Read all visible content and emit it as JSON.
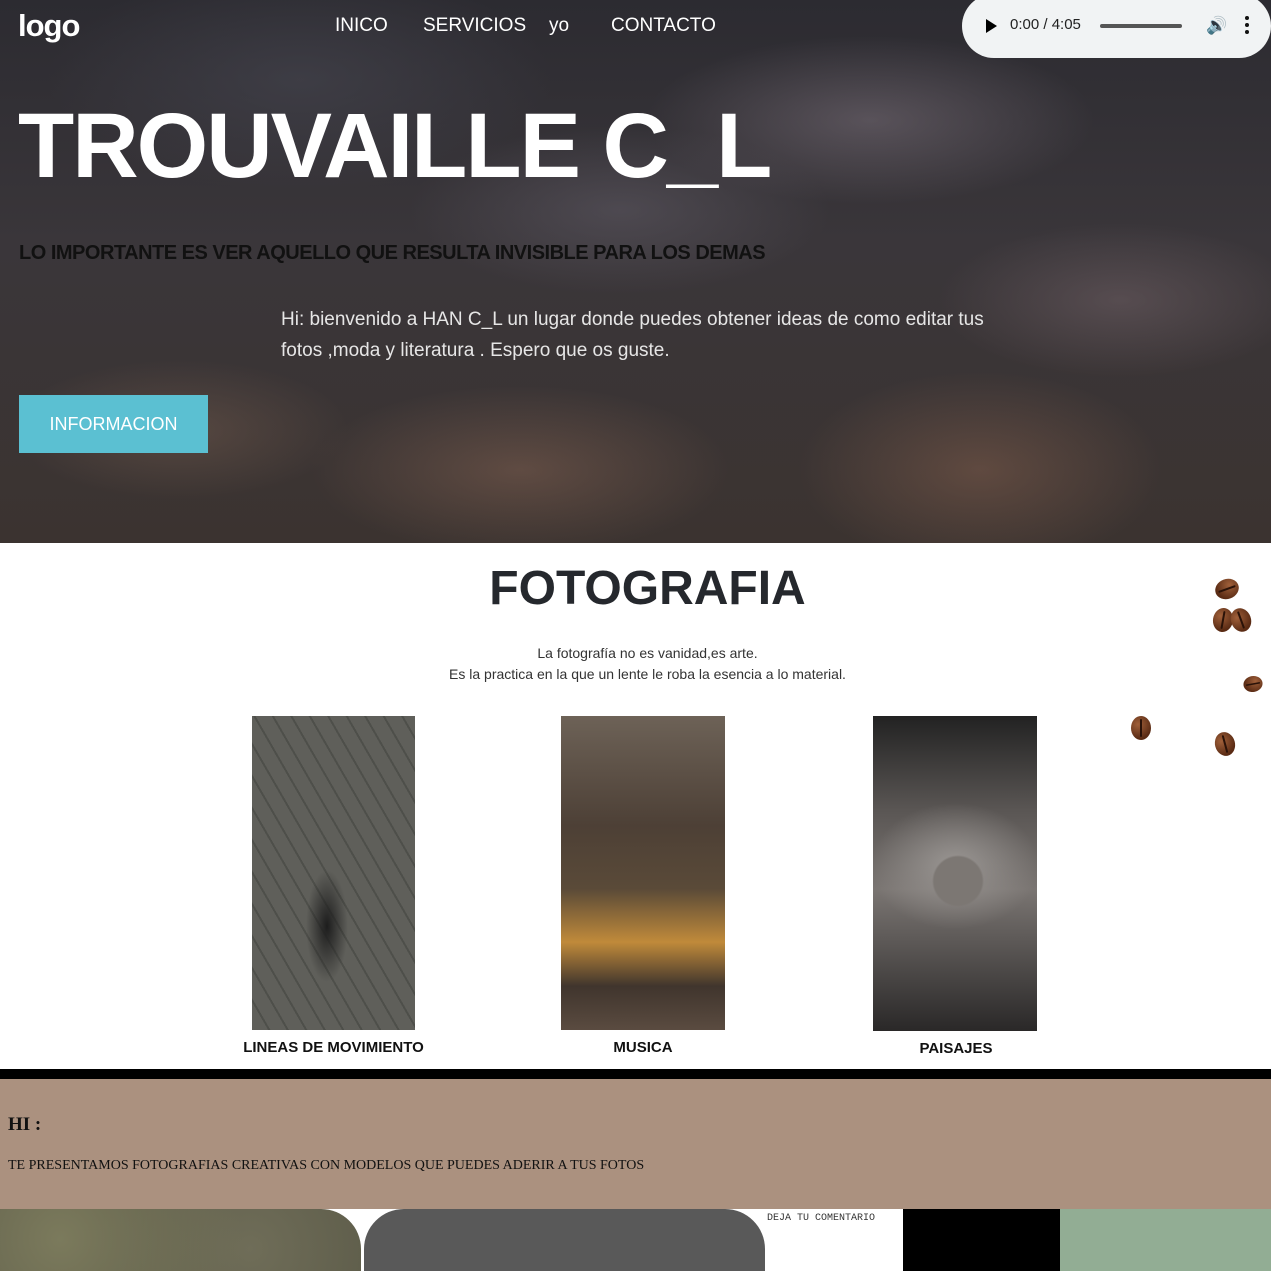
{
  "header": {
    "logo": "logo",
    "nav": [
      "INICO",
      "SERVICIOS",
      "yo",
      "CONTACTO"
    ]
  },
  "audio": {
    "time": "0:00 / 4:05"
  },
  "hero": {
    "title": "TROUVAILLE C_L",
    "subtitle": "LO IMPORTANTE ES VER AQUELLO QUE RESULTA INVISIBLE PARA LOS DEMAS",
    "text": "Hi: bienvenido a HAN C_L un lugar donde puedes obtener ideas de como editar tus fotos ,moda y literatura . Espero que os guste.",
    "button": "INFORMACION"
  },
  "fotografia": {
    "title": "FOTOGRAFIA",
    "quote_line1": "La fotografía no es vanidad,es arte.",
    "quote_line2": "Es la practica en la que un lente le roba la esencia a lo material.",
    "cards": [
      {
        "caption": "LINEAS DE MOVIMIENTO"
      },
      {
        "caption": "MUSICA"
      },
      {
        "caption": "PAISAJES"
      }
    ]
  },
  "hi": {
    "heading": "HI :",
    "text": "TE PRESENTAMOS FOTOGRAFIAS CREATIVAS CON MODELOS QUE PUEDES ADERIR A TUS FOTOS"
  },
  "bottom": {
    "comment_label": "DEJA TU COMENTARIO"
  },
  "colors": {
    "accent": "#5bc0d2",
    "hi_bg": "#ab917f",
    "green": "#92ad94"
  }
}
